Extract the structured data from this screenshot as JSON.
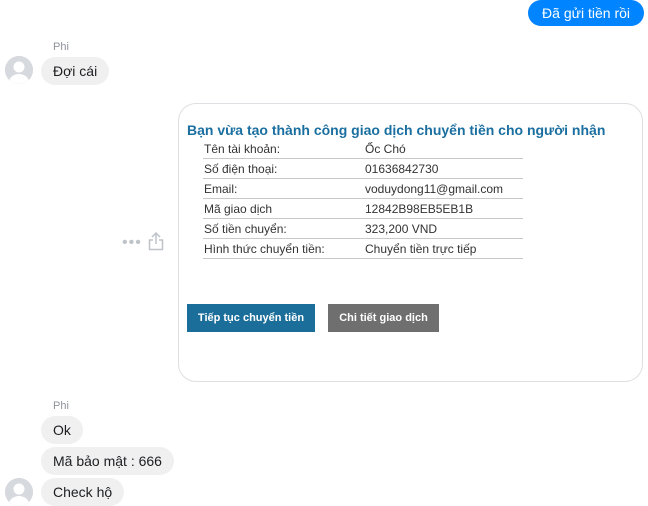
{
  "outgoing": {
    "text": "Đã gửi tiền rồi"
  },
  "group1": {
    "sender": "Phi",
    "message": "Đợi cái"
  },
  "card": {
    "heading": "Bạn vừa tạo thành công giao dịch chuyển tiền cho người nhận",
    "rows": [
      {
        "label": "Tên tài khoản:",
        "value": "Ốc Chó"
      },
      {
        "label": "Số điện thoại:",
        "value": "01636842730"
      },
      {
        "label": "Email:",
        "value": "voduydong11@gmail.com"
      },
      {
        "label": "Mã giao dịch",
        "value": "12842B98EB5EB1B"
      },
      {
        "label": "Số tiền chuyển:",
        "value": "323,200 VND"
      },
      {
        "label": "Hình thức chuyển tiền:",
        "value": "Chuyển tiền trực tiếp"
      }
    ],
    "primary_button": "Tiếp tục chuyển tiền",
    "secondary_button": "Chi tiết giao dịch"
  },
  "actions": {
    "more_icon": "more-dots-icon",
    "share_icon": "share-icon",
    "more_glyph": "•••"
  },
  "group2": {
    "sender": "Phi",
    "messages": [
      "Ok",
      "Mã bảo mật : 666",
      "Check hộ"
    ]
  },
  "colors": {
    "accent": "#0084ff",
    "incoming_bubble": "#f1f0f0",
    "card_heading": "#1a6fa0",
    "primary_button": "#1b6e99",
    "secondary_button": "#6f6f6f"
  }
}
